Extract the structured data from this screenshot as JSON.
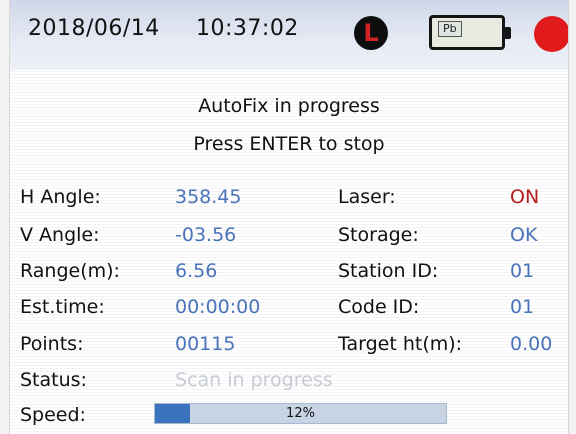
{
  "status_bar": {
    "date": "2018/06/14",
    "time": "10:37:02",
    "laser_icon_letter": "L",
    "battery_label": "Pb",
    "icons": [
      "laser-icon",
      "battery-icon",
      "record-icon"
    ],
    "colors": {
      "laser_letter": "#d42323",
      "record": "#e11b1b"
    }
  },
  "message": {
    "line1": "AutoFix in progress",
    "line2": "Press ENTER to stop"
  },
  "left_fields": [
    {
      "label": "H Angle:",
      "value": "358.45"
    },
    {
      "label": "V Angle:",
      "value": "-03.56"
    },
    {
      "label": "Range(m):",
      "value": "6.56"
    },
    {
      "label": "Est.time:",
      "value": "00:00:00"
    },
    {
      "label": "Points:",
      "value": "00115"
    },
    {
      "label": "Status:",
      "value": "Scan in progress"
    },
    {
      "label": "Speed:",
      "value": "12%"
    }
  ],
  "right_fields": [
    {
      "label": "Laser:",
      "value": "ON"
    },
    {
      "label": "Storage:",
      "value": "OK"
    },
    {
      "label": "Station ID:",
      "value": "01"
    },
    {
      "label": "Code ID:",
      "value": "01"
    },
    {
      "label": "Target ht(m):",
      "value": "0.00"
    }
  ],
  "speed": {
    "fraction": 0.12
  },
  "colors": {
    "value": "#4a74ba",
    "on_value": "#b51d1d",
    "status_value": "#c6cbd4",
    "progress_fill": "#3a72bd"
  }
}
